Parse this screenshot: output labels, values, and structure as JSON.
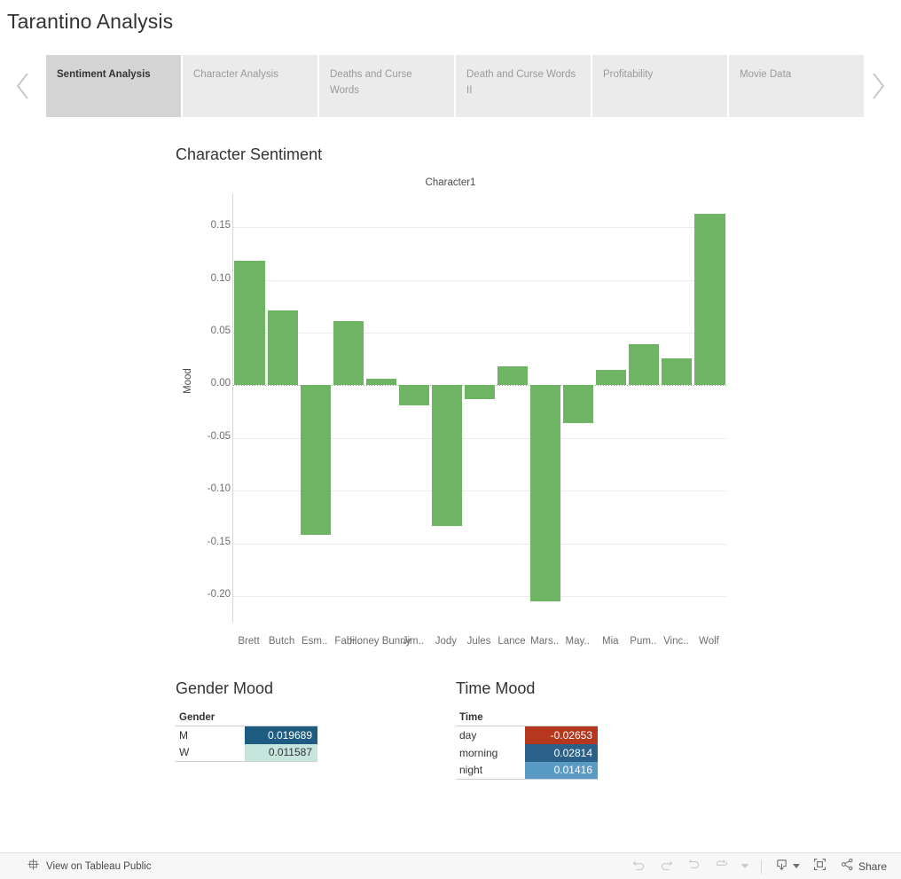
{
  "header": {
    "title": "Tarantino Analysis"
  },
  "tabs": {
    "prev_icon": "chevron-left-icon",
    "next_icon": "chevron-right-icon",
    "items": [
      {
        "label": "Sentiment Analysis",
        "active": true
      },
      {
        "label": "Character Analysis",
        "active": false
      },
      {
        "label": "Deaths and Curse Words",
        "active": false
      },
      {
        "label": "Death and Curse Words II",
        "active": false
      },
      {
        "label": "Profitability",
        "active": false
      },
      {
        "label": "Movie Data",
        "active": false
      }
    ]
  },
  "character_sentiment": {
    "panel_title": "Character Sentiment"
  },
  "gender_mood": {
    "panel_title": "Gender Mood",
    "column_header": "Gender",
    "rows": [
      {
        "key": "M",
        "value": "0.019689",
        "color": "#1F5C82",
        "light_text": true
      },
      {
        "key": "W",
        "value": "0.011587",
        "color": "#C5E5DD",
        "light_text": false
      }
    ]
  },
  "time_mood": {
    "panel_title": "Time Mood",
    "column_header": "Time",
    "rows": [
      {
        "key": "day",
        "value": "-0.02653",
        "color": "#B5381E",
        "light_text": true
      },
      {
        "key": "morning",
        "value": "0.02814",
        "color": "#2B6189",
        "light_text": true
      },
      {
        "key": "night",
        "value": "0.01416",
        "color": "#5A9BC6",
        "light_text": true
      }
    ]
  },
  "toolbar": {
    "view_label": "View on Tableau Public",
    "view_icon": "tableau-logo-icon",
    "undo_icon": "undo-icon",
    "redo_icon": "redo-icon",
    "revert_icon": "revert-icon",
    "refresh_icon": "refresh-icon",
    "refresh_caret_icon": "caret-down-icon",
    "download_icon": "download-icon",
    "download_caret_icon": "caret-down-icon",
    "fullscreen_icon": "fullscreen-icon",
    "share_icon": "share-icon",
    "share_label": "Share"
  },
  "chart_data": {
    "type": "bar",
    "title": "Character Sentiment",
    "column_header": "Character1",
    "xlabel": "",
    "ylabel": "Mood",
    "ylim": [
      -0.225,
      0.182
    ],
    "yticks": [
      0.15,
      0.1,
      0.05,
      0.0,
      -0.05,
      -0.1,
      -0.15,
      -0.2
    ],
    "ytick_labels": [
      "0.15",
      "0.10",
      "0.05",
      "0.00",
      "-0.05",
      "-0.10",
      "-0.15",
      "-0.20"
    ],
    "grid": true,
    "legend": "none",
    "bar_color": "#6FB464",
    "categories": [
      "Brett",
      "Butch",
      "Esm..",
      "Fabi..",
      "Honey Bunny",
      "Jim..",
      "Jody",
      "Jules",
      "Lance",
      "Mars..",
      "May..",
      "Mia",
      "Pum..",
      "Vinc..",
      "Wolf"
    ],
    "values": [
      0.118,
      0.071,
      -0.142,
      0.061,
      0.006,
      -0.019,
      -0.133,
      -0.013,
      0.018,
      -0.205,
      -0.036,
      0.015,
      0.039,
      0.026,
      0.163
    ]
  }
}
